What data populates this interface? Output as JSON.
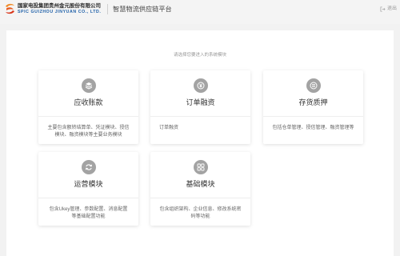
{
  "header": {
    "company_name_cn": "国家电投集团贵州金元股份有限公司",
    "company_name_en": "SPIC GUIZHOU JINYUAN CO., LTD.",
    "platform_title": "智慧物流供应链平台",
    "logout_label": "退出",
    "logo_icon": "company-logo",
    "logout_icon": "logout-icon"
  },
  "main": {
    "prompt": "请选择您要进入的系统模块",
    "modules": [
      {
        "title": "应收账款",
        "description": "主要包含额转结算单、凭证模块、授信模块、融资模块等主要业务模块",
        "icon": "layers-icon"
      },
      {
        "title": "订单融资",
        "description": "订单融资",
        "icon": "yuan-coin-icon"
      },
      {
        "title": "存货质押",
        "description": "包括仓单管理、授信管理、融资管理等",
        "icon": "coins-icon"
      },
      {
        "title": "运营模块",
        "description": "包含Ukey管理、参数配置、消息配置等基础配置功能",
        "icon": "refresh-icon"
      },
      {
        "title": "基础模块",
        "description": "包含组织架构、企业信息、修改系统密码等功能",
        "icon": "grid-icon"
      }
    ]
  },
  "colors": {
    "brand_blue": "#1d5fa8",
    "logo_orange": "#e85a1e",
    "icon_gray": "#a3a3a3",
    "page_background": "#f2f2f2"
  }
}
